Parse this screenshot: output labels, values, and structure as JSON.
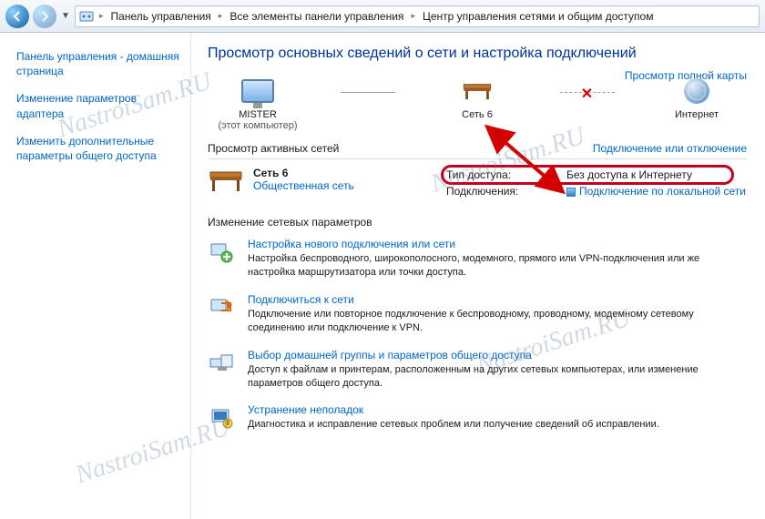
{
  "breadcrumb": {
    "items": [
      "Панель управления",
      "Все элементы панели управления",
      "Центр управления сетями и общим доступом"
    ]
  },
  "sidebar": {
    "home": "Панель управления - домашняя страница",
    "adapter": "Изменение параметров адаптера",
    "sharing": "Изменить дополнительные параметры общего доступа"
  },
  "page": {
    "title": "Просмотр основных сведений о сети и настройка подключений",
    "full_map": "Просмотр полной карты",
    "node_pc": "MISTER",
    "node_pc_sub": "(этот компьютер)",
    "node_net": "Сеть 6",
    "node_internet": "Интернет",
    "active_header": "Просмотр активных сетей",
    "connect_link": "Подключение или отключение",
    "net_name": "Сеть 6",
    "net_type": "Общественная сеть",
    "access_lbl": "Тип доступа:",
    "access_val": "Без доступа к Интернету",
    "conn_lbl": "Подключения:",
    "conn_val": "Подключение по локальной сети",
    "settings_hdr": "Изменение сетевых параметров"
  },
  "options": [
    {
      "title": "Настройка нового подключения или сети",
      "desc": "Настройка беспроводного, широкополосного, модемного, прямого или VPN-подключения или же настройка маршрутизатора или точки доступа."
    },
    {
      "title": "Подключиться к сети",
      "desc": "Подключение или повторное подключение к беспроводному, проводному, модемному сетевому соединению или подключение к VPN."
    },
    {
      "title": "Выбор домашней группы и параметров общего доступа",
      "desc": "Доступ к файлам и принтерам, расположенным на других сетевых компьютерах, или изменение параметров общего доступа."
    },
    {
      "title": "Устранение неполадок",
      "desc": "Диагностика и исправление сетевых проблем или получение сведений об исправлении."
    }
  ],
  "watermark": "NastroiSam.RU"
}
